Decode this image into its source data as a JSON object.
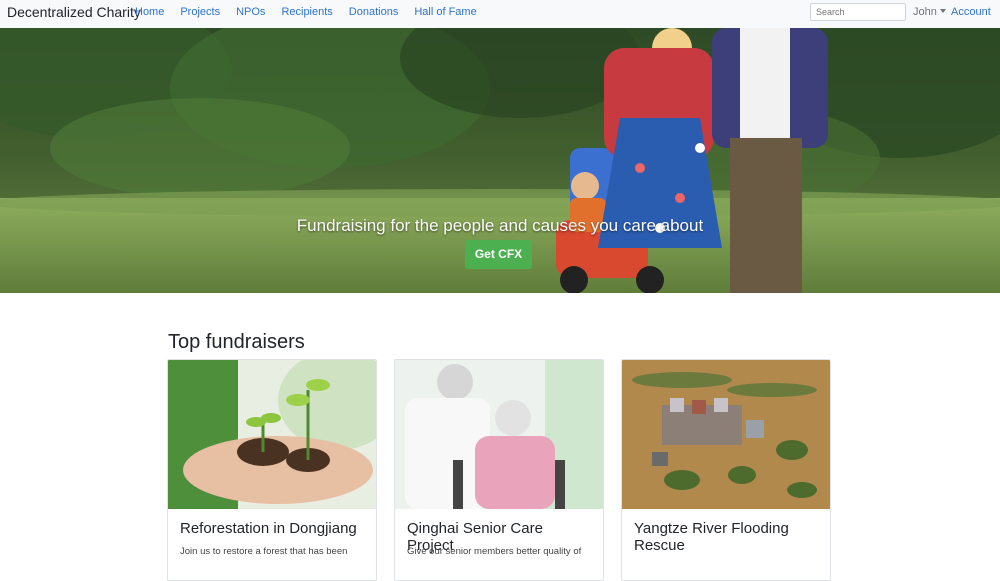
{
  "navbar": {
    "brand": "Decentralized Charity",
    "links": [
      "Home",
      "Projects",
      "NPOs",
      "Recipients",
      "Donations",
      "Hall of Fame"
    ],
    "search_placeholder": "Search",
    "user": "John",
    "account": "Account"
  },
  "hero": {
    "title": "Fundraising for the people and causes you care about",
    "button": "Get CFX"
  },
  "fundraisers": {
    "heading": "Top fundraisers",
    "cards": [
      {
        "title": "Reforestation in Dongjiang",
        "text": "Join us to restore a forest that has been"
      },
      {
        "title": "Qinghai Senior Care Project",
        "text": "Give our senior members better quality of"
      },
      {
        "title": "Yangtze River Flooding Rescue",
        "text": ""
      }
    ]
  },
  "colors": {
    "link": "#2f73c9",
    "cta": "#4caf50",
    "navbar_bg": "#f8f9fa"
  }
}
